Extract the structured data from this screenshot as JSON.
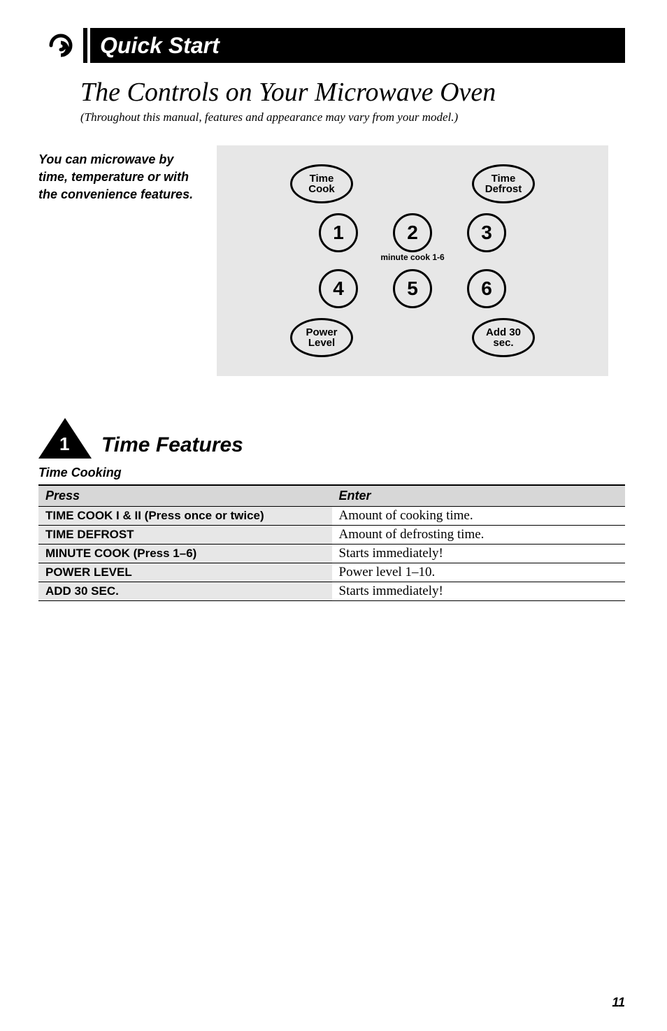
{
  "header": {
    "title": "Quick Start"
  },
  "main": {
    "title": "The Controls on Your Microwave Oven",
    "subtitle": "(Throughout this manual, features and appearance may vary from your model.)",
    "sideText": "You can microwave by time, temperature or with the convenience features."
  },
  "panel": {
    "timeCook": "Time\nCook",
    "timeDefrost": "Time\nDefrost",
    "numbers": [
      "1",
      "2",
      "3",
      "4",
      "5",
      "6"
    ],
    "minuteLabel": "minute cook 1-6",
    "powerLevel": "Power\nLevel",
    "add30": "Add 30\nsec."
  },
  "section": {
    "triangleNum": "1",
    "title": "Time Features",
    "subsection": "Time Cooking",
    "tableHeaders": {
      "press": "Press",
      "enter": "Enter"
    },
    "rows": [
      {
        "press": "TIME COOK I & II (Press once or twice)",
        "enter": "Amount of cooking time."
      },
      {
        "press": "TIME DEFROST",
        "enter": "Amount of defrosting time."
      },
      {
        "press": "MINUTE COOK (Press 1–6)",
        "enter": "Starts immediately!"
      },
      {
        "press": "POWER LEVEL",
        "enter": "Power level 1–10."
      },
      {
        "press": "ADD 30 SEC.",
        "enter": "Starts immediately!"
      }
    ]
  },
  "pageNumber": "11"
}
